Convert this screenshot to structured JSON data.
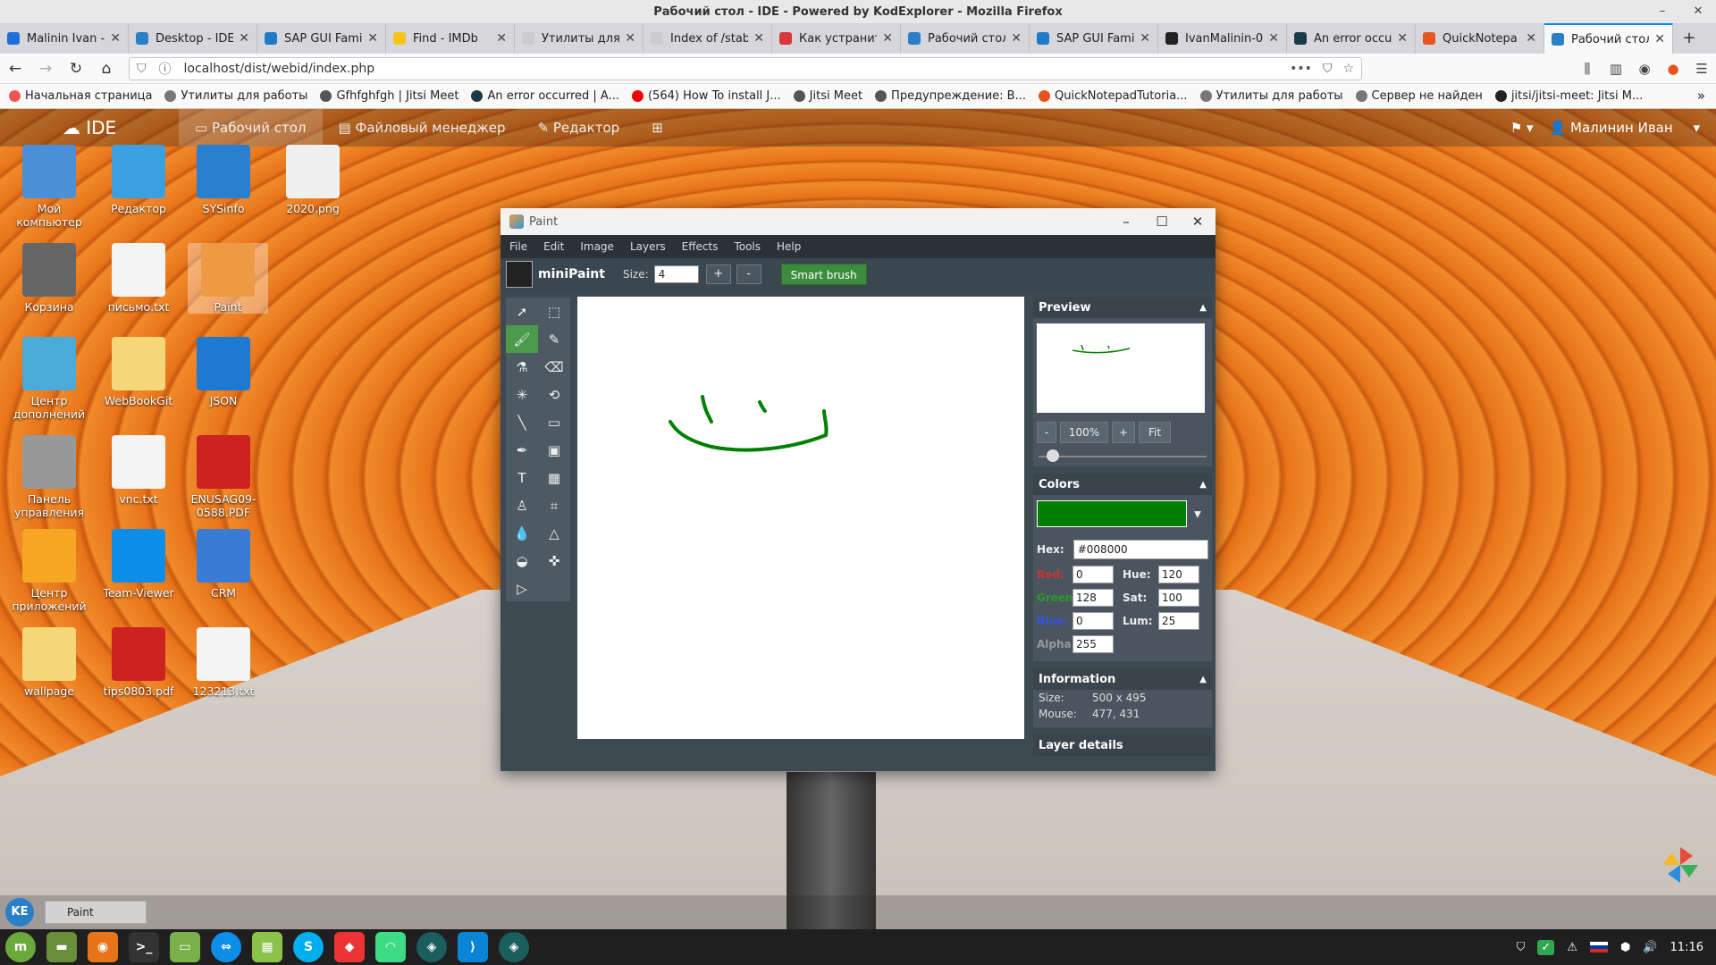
{
  "window": {
    "title": "Рабочий стол - IDE - Powered by KodExplorer - Mozilla Firefox"
  },
  "tabs": [
    {
      "label": "Malinin Ivan -",
      "color": "#1e6fd9"
    },
    {
      "label": "Desktop - IDE",
      "color": "#2a7fc9"
    },
    {
      "label": "SAP GUI Famil",
      "color": "#1f7ac9"
    },
    {
      "label": "Find - IMDb",
      "color": "#f5c518"
    },
    {
      "label": "Утилиты для раб",
      "color": "#cccccc"
    },
    {
      "label": "Index of /stable/",
      "color": "#cccccc"
    },
    {
      "label": "Как устранит",
      "color": "#d9363e"
    },
    {
      "label": "Рабочий стол",
      "color": "#2a7fc9"
    },
    {
      "label": "SAP GUI Famil",
      "color": "#1f7ac9"
    },
    {
      "label": "IvanMalinin-0",
      "color": "#222222"
    },
    {
      "label": "An error occu",
      "color": "#1a3a4a"
    },
    {
      "label": "QuickNotepa",
      "color": "#e8541e"
    },
    {
      "label": "Рабочий стол",
      "color": "#2a7fc9",
      "active": true
    }
  ],
  "url": "localhost/dist/webid/index.php",
  "bookmarks": [
    {
      "label": "Начальная страница",
      "color": "#e55"
    },
    {
      "label": "Утилиты для работы",
      "color": "#777"
    },
    {
      "label": "Gfhfghfgh | Jitsi Meet",
      "color": "#555"
    },
    {
      "label": "An error occurred | A...",
      "color": "#1a3a4a"
    },
    {
      "label": "(564) How To install J...",
      "color": "#e00"
    },
    {
      "label": "Jitsi Meet",
      "color": "#555"
    },
    {
      "label": "Предупреждение: В...",
      "color": "#555"
    },
    {
      "label": "QuickNotepadTutoria...",
      "color": "#e8541e"
    },
    {
      "label": "Утилиты для работы",
      "color": "#777"
    },
    {
      "label": "Сервер не найден",
      "color": "#777"
    },
    {
      "label": "jitsi/jitsi-meet: Jitsi M...",
      "color": "#222"
    }
  ],
  "ide": {
    "logo": "IDE",
    "nav": [
      "Рабочий стол",
      "Файловый менеджер",
      "Редактор"
    ],
    "user": "Малинин Иван"
  },
  "desktop_icons": [
    {
      "label": "Мой компьютер",
      "color": "#4a8fd8"
    },
    {
      "label": "Редактор",
      "color": "#3aa0e0"
    },
    {
      "label": "SYSinfo",
      "color": "#2a7fd0"
    },
    {
      "label": "2020.png",
      "color": "#f0f0f0"
    },
    {
      "label": "Корзина",
      "color": "#666"
    },
    {
      "label": "письмо.txt",
      "color": "#f4f4f4"
    },
    {
      "label": "Paint",
      "color": "#e94"
    },
    {
      "label": "Центр дополнений",
      "color": "#4aaad8"
    },
    {
      "label": "WebBookGit",
      "color": "#f5d77a"
    },
    {
      "label": "JSON",
      "color": "#1e7ad0"
    },
    {
      "label": "Панель управления",
      "color": "#999"
    },
    {
      "label": "vnc.txt",
      "color": "#f4f4f4"
    },
    {
      "label": "ENUSAG09-0588.PDF",
      "color": "#cc2222"
    },
    {
      "label": "Центр приложений",
      "color": "#f5a623"
    },
    {
      "label": "Team-Viewer",
      "color": "#0e8ee9"
    },
    {
      "label": "CRM",
      "color": "#3a7bd5"
    },
    {
      "label": "wallpage",
      "color": "#f5d77a"
    },
    {
      "label": "tips0803.pdf",
      "color": "#cc2222"
    },
    {
      "label": "123213.txt",
      "color": "#f4f4f4"
    }
  ],
  "paint": {
    "title": "Paint",
    "menu": [
      "File",
      "Edit",
      "Image",
      "Layers",
      "Effects",
      "Tools",
      "Help"
    ],
    "app_name": "miniPaint",
    "size_label": "Size:",
    "size_value": "4",
    "plus": "+",
    "minus": "-",
    "smart_brush": "Smart brush",
    "preview": {
      "title": "Preview",
      "zoom": "100%",
      "fit": "Fit",
      "minus": "-",
      "plus": "+"
    },
    "colors": {
      "title": "Colors",
      "hex_label": "Hex:",
      "hex": "#008000",
      "red_label": "Red:",
      "red": "0",
      "green_label": "Green:",
      "green": "128",
      "blue_label": "Blue:",
      "blue": "0",
      "alpha_label": "Alpha:",
      "alpha": "255",
      "hue_label": "Hue:",
      "hue": "120",
      "sat_label": "Sat:",
      "sat": "100",
      "lum_label": "Lum:",
      "lum": "25",
      "active_color": "#008000"
    },
    "info": {
      "title": "Information",
      "size_label": "Size:",
      "size": "500 x 495",
      "mouse_label": "Mouse:",
      "mouse": "477, 431"
    },
    "layer_details_title": "Layer details"
  },
  "taskbar": {
    "kodexplorer_button": "KE",
    "task": "Paint"
  },
  "tray": {
    "time": "11:16"
  }
}
